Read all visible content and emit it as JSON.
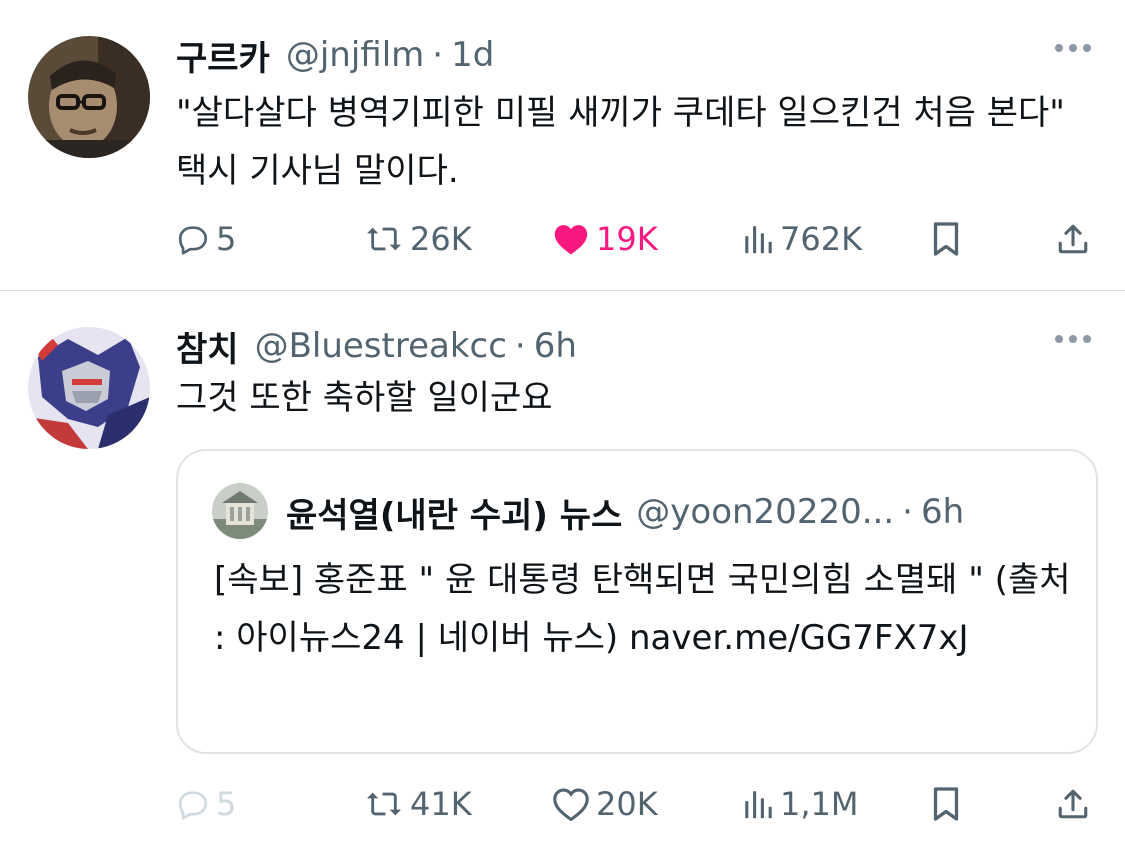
{
  "tweets": [
    {
      "name": "구르카",
      "handle": "@jnjfilm",
      "separator": "·",
      "time": "1d",
      "text": "\"살다살다 병역기피한 미필 새끼가 쿠데타 일으킨건 처음 본다\" 택시 기사님 말이다.",
      "replies": "5",
      "reposts": "26K",
      "likes": "19K",
      "views": "762K",
      "liked": true
    },
    {
      "name": "참치",
      "handle": "@Bluestreakcc",
      "separator": "·",
      "time": "6h",
      "text": "그것 또한 축하할 일이군요",
      "replies": "5",
      "reposts": "41K",
      "likes": "20K",
      "views": "1,1M",
      "liked": false,
      "quote": {
        "name": "윤석열(내란 수괴) 뉴스",
        "handle": "@yoon20220...",
        "separator": "·",
        "time": "6h",
        "text": "[속보] 홍준표 \" 윤 대통령 탄핵되면 국민의힘 소멸돼 \" (출처 : 아이뉴스24 | 네이버 뉴스) naver.me/GG7FX7xJ"
      }
    }
  ],
  "icons": {
    "reply": "reply-icon",
    "repost": "repost-icon",
    "like": "heart-icon",
    "views": "views-icon",
    "bookmark": "bookmark-icon",
    "share": "share-icon",
    "more": "more-icon"
  },
  "colors": {
    "like": "#f91880",
    "secondary_text": "#536471",
    "divider": "#d9dde1"
  }
}
